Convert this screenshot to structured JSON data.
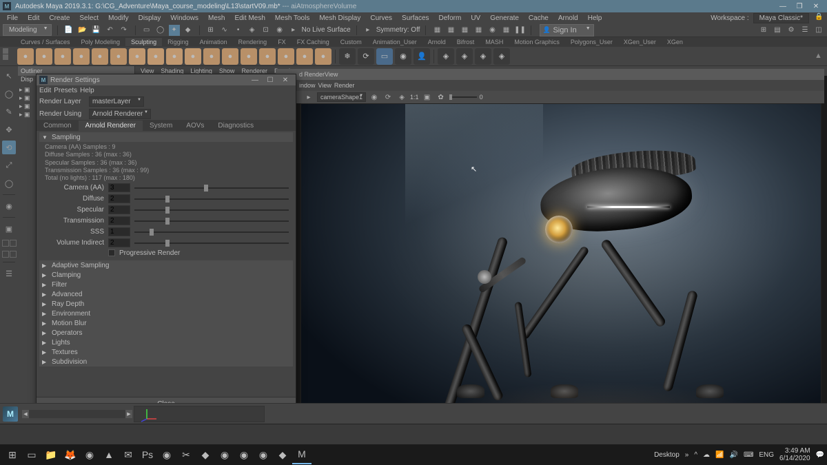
{
  "titlebar": {
    "app_prefix": "Autodesk Maya 2019.3.1:",
    "file_path": "G:\\CG_Adventure\\Maya_course_modeling\\L13\\startV09.mb*",
    "suffix": "---  aiAtmosphereVolume"
  },
  "menubar": {
    "items": [
      "File",
      "Edit",
      "Create",
      "Select",
      "Modify",
      "Display",
      "Windows",
      "Mesh",
      "Edit Mesh",
      "Mesh Tools",
      "Mesh Display",
      "Curves",
      "Surfaces",
      "Deform",
      "UV",
      "Generate",
      "Cache",
      "Arnold",
      "Help"
    ],
    "workspace_label": "Workspace :",
    "workspace_value": "Maya Classic*"
  },
  "toolbar1": {
    "mode": "Modeling",
    "live_surface": "No Live Surface",
    "symmetry": "Symmetry: Off",
    "signin": "Sign In"
  },
  "shelf": {
    "tabs": [
      "Curves / Surfaces",
      "Poly Modeling",
      "Sculpting",
      "Rigging",
      "Animation",
      "Rendering",
      "FX",
      "FX Caching",
      "Custom",
      "Animation_User",
      "Arnold",
      "Bifrost",
      "MASH",
      "Motion Graphics",
      "Polygons_User",
      "XGen_User",
      "XGen"
    ],
    "active_tab": "Sculpting"
  },
  "outliner": {
    "title": "Outliner",
    "display_menu": "Disp"
  },
  "viewport": {
    "menus": [
      "View",
      "Shading",
      "Lighting",
      "Show",
      "Renderer",
      "Panels"
    ]
  },
  "renderview": {
    "title": "d RenderView",
    "menus": [
      "indow",
      "View",
      "Render"
    ],
    "camera": "cameraShape1",
    "ratio_label": "1:1",
    "exposure_val": "0"
  },
  "render_settings": {
    "title": "Render Settings",
    "menus": [
      "Edit",
      "Presets",
      "Help"
    ],
    "render_layer_label": "Render Layer",
    "render_layer_value": "masterLayer",
    "render_using_label": "Render Using",
    "render_using_value": "Arnold Renderer",
    "tabs": [
      "Common",
      "Arnold Renderer",
      "System",
      "AOVs",
      "Diagnostics"
    ],
    "active_tab": "Arnold Renderer",
    "sampling": {
      "title": "Sampling",
      "stats": [
        "Camera (AA) Samples : 9",
        "Diffuse Samples : 36 (max : 36)",
        "Specular Samples : 36 (max : 36)",
        "Transmission Samples : 36 (max : 99)",
        "Total (no lights) : 117 (max : 180)"
      ],
      "sliders": [
        {
          "label": "Camera (AA)",
          "value": "3",
          "pos": 45
        },
        {
          "label": "Diffuse",
          "value": "2",
          "pos": 20
        },
        {
          "label": "Specular",
          "value": "2",
          "pos": 20
        },
        {
          "label": "Transmission",
          "value": "2",
          "pos": 20
        },
        {
          "label": "SSS",
          "value": "1",
          "pos": 10
        },
        {
          "label": "Volume Indirect",
          "value": "2",
          "pos": 20
        }
      ],
      "progressive_label": "Progressive Render"
    },
    "collapsed_sections": [
      "Adaptive Sampling",
      "Clamping",
      "Filter",
      "Advanced",
      "Ray Depth",
      "Environment",
      "Motion Blur",
      "Operators",
      "Lights",
      "Textures",
      "Subdivision"
    ],
    "close_btn": "Close"
  },
  "taskbar": {
    "desktop_label": "Desktop",
    "lang": "ENG",
    "time": "3:49 AM",
    "date": "6/14/2020"
  }
}
